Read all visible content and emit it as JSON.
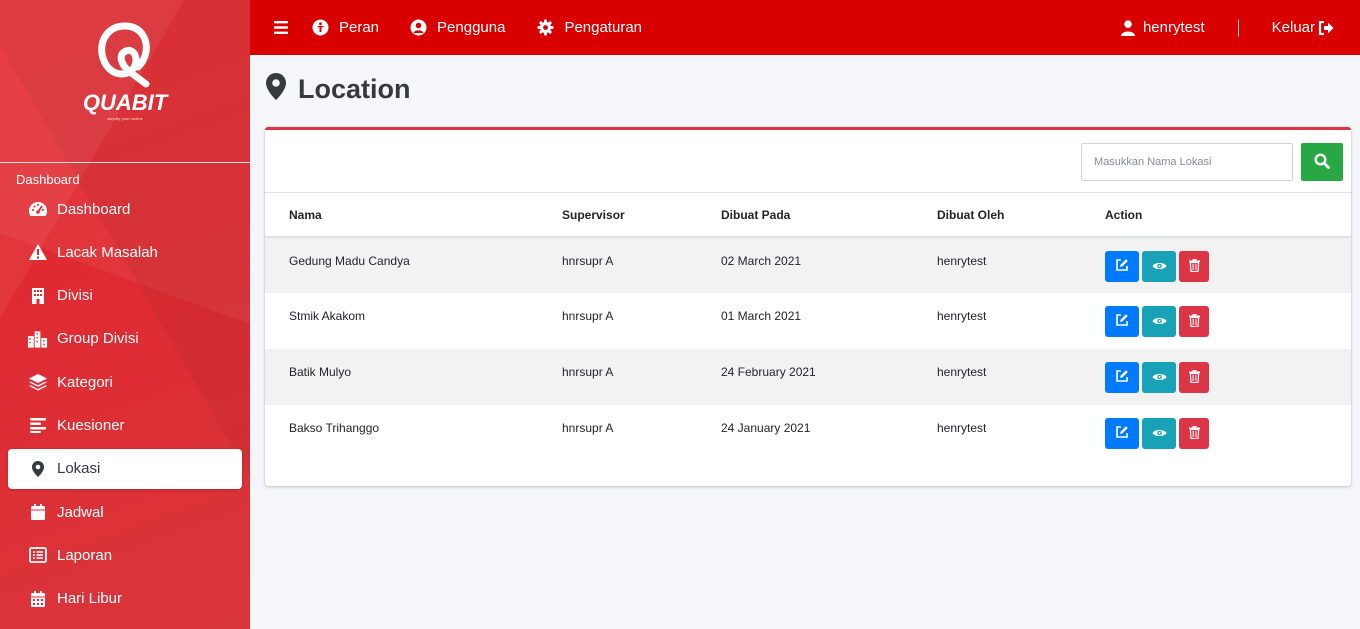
{
  "app": {
    "brand": "QUABIT",
    "tagline": "simplify your routine"
  },
  "sidebar": {
    "section": "Dashboard",
    "items": [
      {
        "label": "Dashboard",
        "icon": "tachometer-icon"
      },
      {
        "label": "Lacak Masalah",
        "icon": "warning-icon"
      },
      {
        "label": "Divisi",
        "icon": "building-icon"
      },
      {
        "label": "Group Divisi",
        "icon": "city-icon"
      },
      {
        "label": "Kategori",
        "icon": "layers-icon"
      },
      {
        "label": "Kuesioner",
        "icon": "align-left-icon"
      },
      {
        "label": "Lokasi",
        "icon": "map-marker-icon",
        "active": true
      },
      {
        "label": "Jadwal",
        "icon": "calendar-icon"
      },
      {
        "label": "Laporan",
        "icon": "list-alt-icon"
      },
      {
        "label": "Hari Libur",
        "icon": "calendar-days-icon"
      }
    ]
  },
  "topbar": {
    "menu_icon": "hamburger-icon",
    "items": [
      {
        "label": "Peran",
        "icon": "info-circle-icon"
      },
      {
        "label": "Pengguna",
        "icon": "user-circle-icon"
      },
      {
        "label": "Pengaturan",
        "icon": "gear-icon"
      }
    ],
    "user": "henrytest",
    "logout": "Keluar"
  },
  "page": {
    "title": "Location",
    "icon": "map-marker-icon"
  },
  "search": {
    "placeholder": "Masukkan Nama Lokasi"
  },
  "table": {
    "columns": [
      "Nama",
      "Supervisor",
      "Dibuat Pada",
      "Dibuat Oleh",
      "Action"
    ],
    "rows": [
      {
        "nama": "Gedung Madu Candya",
        "supervisor": "hnrsupr A",
        "dibuat_pada": "02 March 2021",
        "dibuat_oleh": "henrytest"
      },
      {
        "nama": "Stmik Akakom",
        "supervisor": "hnrsupr A",
        "dibuat_pada": "01 March 2021",
        "dibuat_oleh": "henrytest"
      },
      {
        "nama": "Batik Mulyo",
        "supervisor": "hnrsupr A",
        "dibuat_pada": "24 February 2021",
        "dibuat_oleh": "henrytest"
      },
      {
        "nama": "Bakso Trihanggo",
        "supervisor": "hnrsupr A",
        "dibuat_pada": "24 January 2021",
        "dibuat_oleh": "henrytest"
      }
    ]
  },
  "colors": {
    "primary": "#d80000",
    "sidebar": "#e5262d",
    "edit": "#007bff",
    "view": "#17a2b8",
    "delete": "#dc3545",
    "search": "#28a745"
  }
}
